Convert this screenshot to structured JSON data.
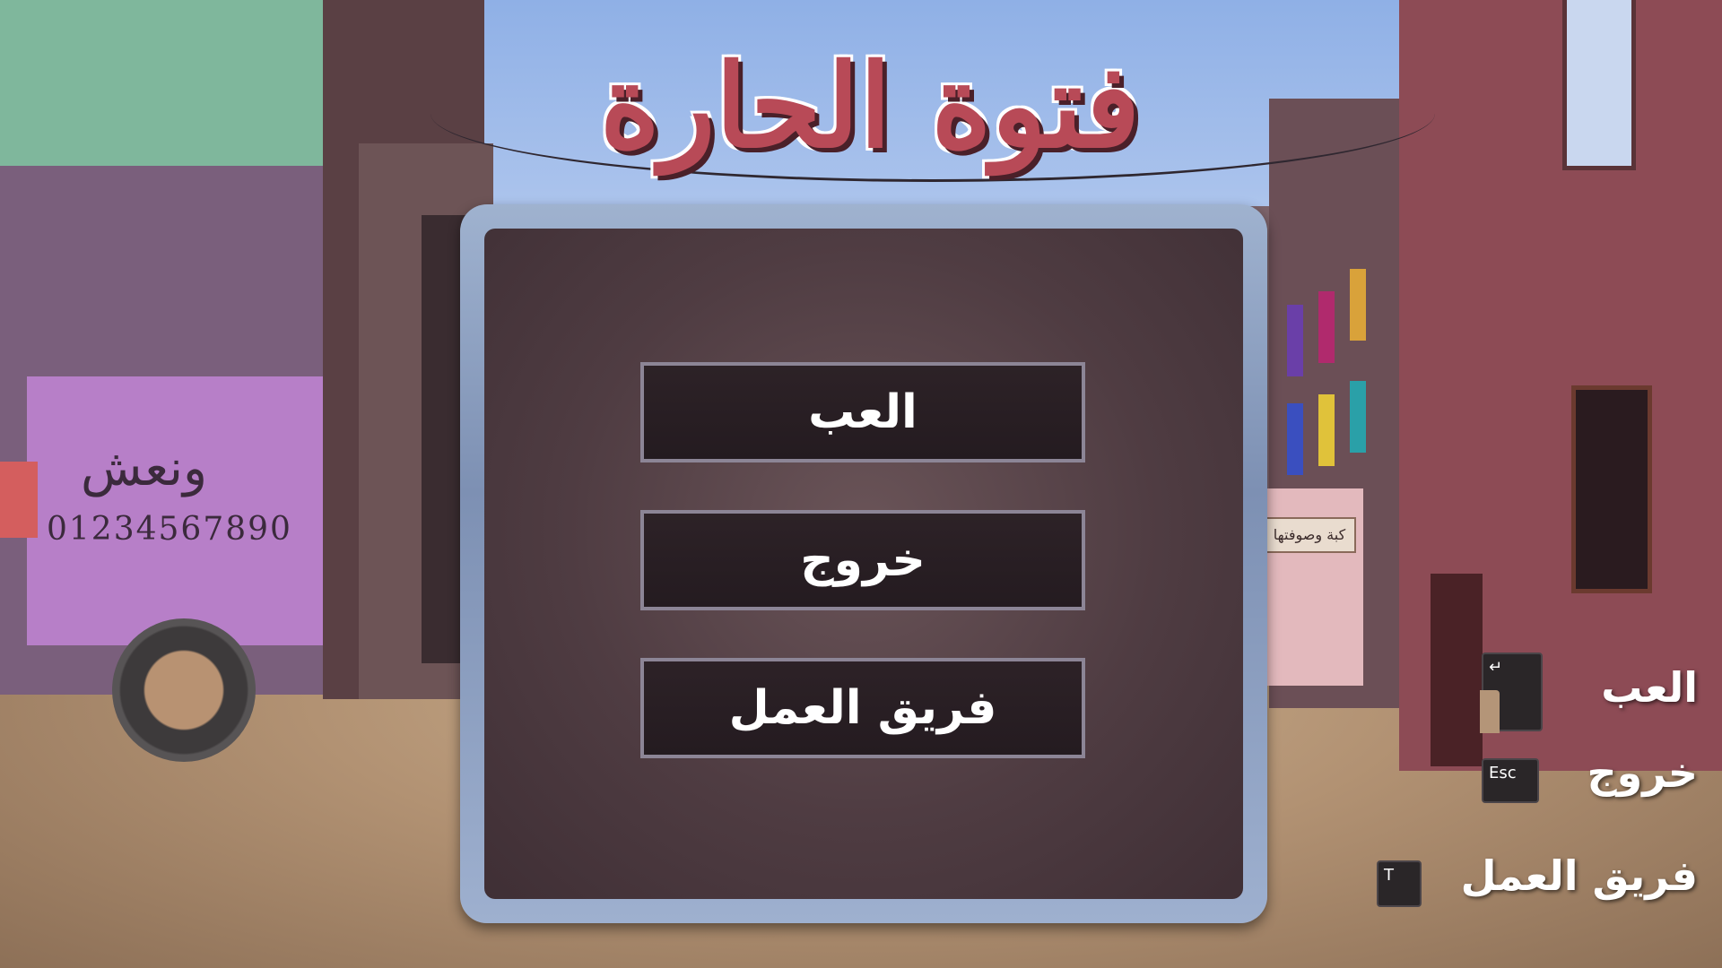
{
  "game": {
    "title": "فتوة الحارة"
  },
  "menu": {
    "play_label": "العب",
    "exit_label": "خروج",
    "team_label": "فريق العمل"
  },
  "hints": [
    {
      "label": "العب",
      "key": "↵"
    },
    {
      "label": "خروج",
      "key": "Esc"
    },
    {
      "label": "فريق العمل",
      "key": "T"
    }
  ],
  "scenery": {
    "wall_graffiti": "ونعش",
    "wall_number": "01234567890",
    "shop_sign": "كبة وصوفتها"
  },
  "colors": {
    "title": "#b84a57",
    "button_bg": "#241b20",
    "button_border": "#8c8596",
    "panel_frame": "#9fb2cf",
    "panel_bg": "#4f3c42"
  }
}
